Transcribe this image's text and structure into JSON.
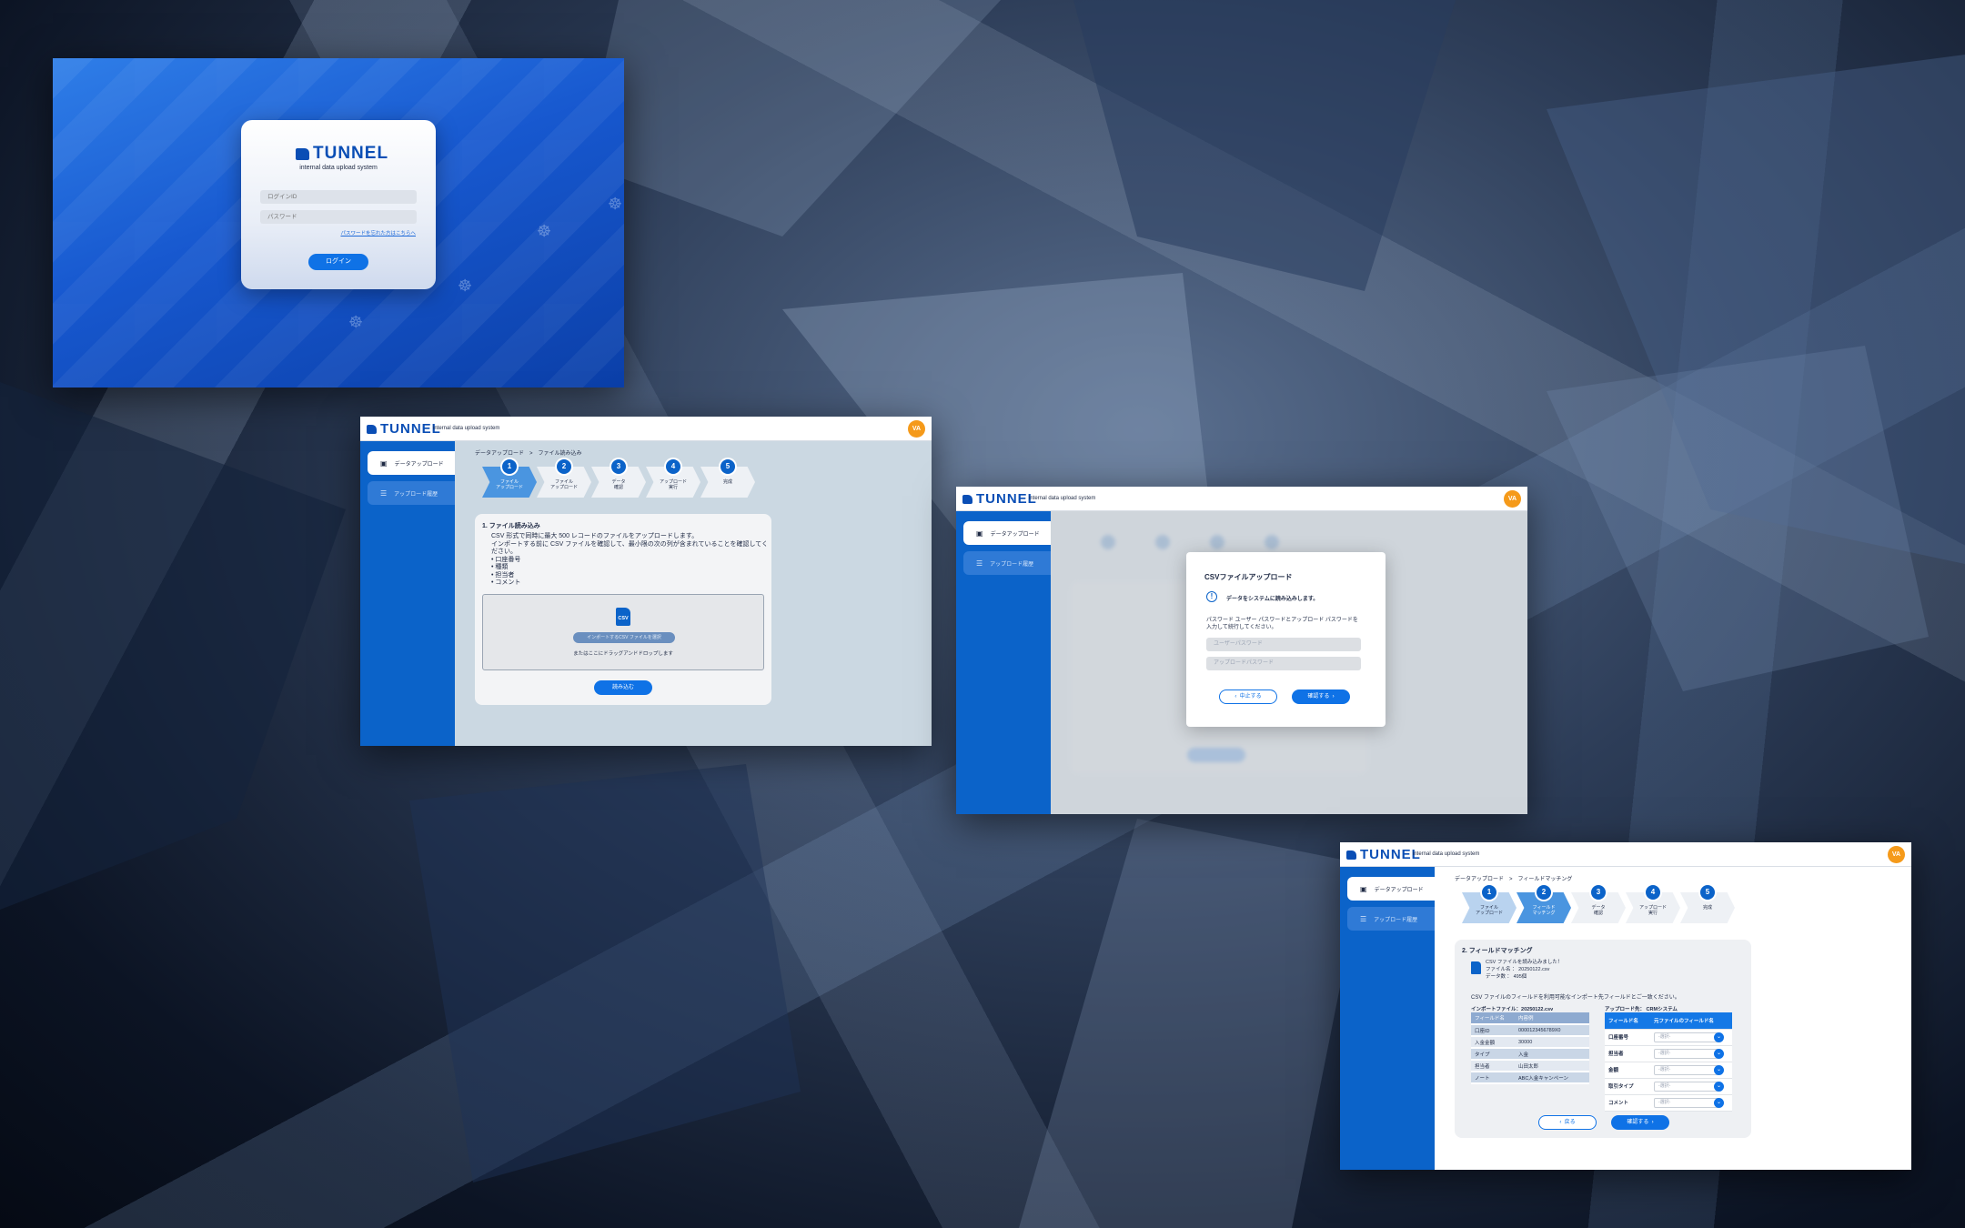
{
  "brand": {
    "name": "TUNNEL",
    "tagline": "internal data upload system",
    "avatar_initials": "VA",
    "accent": "#0b63c9",
    "avatar_color": "#f59a1a"
  },
  "login": {
    "user_placeholder": "ログインID",
    "password_placeholder": "パスワード",
    "forgot_link": "パスワードを忘れた方はこちらへ",
    "login_button": "ログイン"
  },
  "sidebar": {
    "items": [
      {
        "label": "データアップロード",
        "icon": "upload-icon"
      },
      {
        "label": "アップロード履歴",
        "icon": "history-list-icon"
      }
    ]
  },
  "steps": [
    {
      "num": "1",
      "line1": "ファイル",
      "line2": "アップロード"
    },
    {
      "num": "2",
      "line1": "ファイル",
      "line2": "アップロード"
    },
    {
      "num": "3",
      "line1": "データ",
      "line2": "確認"
    },
    {
      "num": "4",
      "line1": "アップロード",
      "line2": "実行"
    },
    {
      "num": "5",
      "line1": "完成",
      "line2": ""
    }
  ],
  "steps_s4": [
    {
      "num": "1",
      "line1": "ファイル",
      "line2": "アップロード"
    },
    {
      "num": "2",
      "line1": "フィールド",
      "line2": "マッチング"
    },
    {
      "num": "3",
      "line1": "データ",
      "line2": "確認"
    },
    {
      "num": "4",
      "line1": "アップロード",
      "line2": "実行"
    },
    {
      "num": "5",
      "line1": "完成",
      "line2": ""
    }
  ],
  "upload": {
    "breadcrumb": "データアップロード　>　ファイル読み込み",
    "section_title": "1. ファイル読み込み",
    "line1": "CSV 形式で同時に最大 500 レコードのファイルをアップロードします。",
    "line2": "インポートする前に CSV ファイルを確認して、最小限の次の列が含まれていることを確認してください。",
    "required_columns": [
      "口座番号",
      "種類",
      "担当者",
      "コメント"
    ],
    "csv_label": "CSV",
    "select_button": "インポートするCSV ファイルを選択",
    "drop_text": "またはここにドラッグアンドドロップします",
    "load_button": "読み込む"
  },
  "modal": {
    "title": "CSVファイルアップロード",
    "notice": "データをシステムに読み込みします。",
    "instruction1": "パスワード ユーザー パスワードとアップロード パスワードを",
    "instruction2": "入力して続行してください。",
    "user_password_placeholder": "ユーザーパスワード",
    "upload_password_placeholder": "アップロードパスワード",
    "cancel_button": "中止する",
    "confirm_button": "確認する"
  },
  "matching": {
    "breadcrumb": "データアップロード　>　フィールドマッチング",
    "section_title": "2. フィールドマッチング",
    "loaded_msg": "CSV ファイルを読み込みました！",
    "file_label": "ファイル名",
    "file_name": "20250122.csv",
    "count_label": "データ数",
    "count_value": "495個",
    "instruction": "CSV ファイルのフィールドを利用可能なインポート先フィールドとご一致ください。",
    "import_file_label": "インポートファイル：",
    "import_file_name": "20250122.csv",
    "target_label": "アップロード先：",
    "target_name": "CRMシステム",
    "left_headers": [
      "フィールド名",
      "内容例"
    ],
    "left_rows": [
      [
        "口座ID",
        "0000123456789X0"
      ],
      [
        "入金金額",
        "30000"
      ],
      [
        "タイプ",
        "入金"
      ],
      [
        "担当者",
        "山田太郎"
      ],
      [
        "ノート",
        "ABC入金キャンペーン"
      ]
    ],
    "right_headers": [
      "フィールド名",
      "元ファイルのフィールド名"
    ],
    "right_rows": [
      "口座番号",
      "担当者",
      "金額",
      "取引タイプ",
      "コメント"
    ],
    "select_placeholder": "-選択-",
    "back_button": "戻る",
    "confirm_button": "確認する"
  }
}
